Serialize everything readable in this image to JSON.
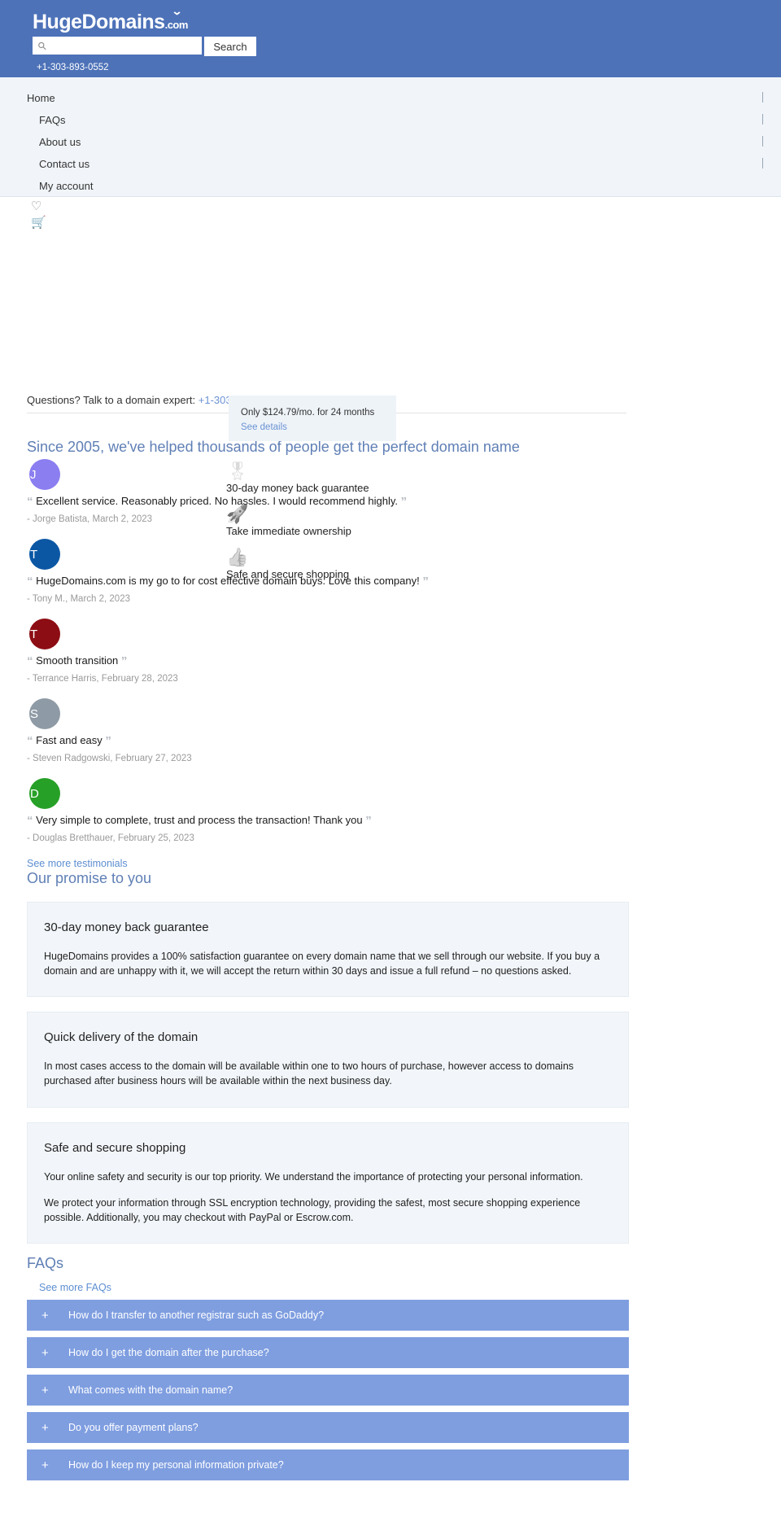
{
  "header": {
    "logo_main": "HugeDomains",
    "logo_suffix": ".com",
    "search_placeholder": "",
    "search_value": "",
    "search_button": "Search",
    "phone": "+1-303-893-0552",
    "search_icon": "search-icon",
    "brand_color": "#4d72b8"
  },
  "nav": {
    "items": [
      {
        "label": "Home",
        "sub": false
      },
      {
        "label": "FAQs",
        "sub": true
      },
      {
        "label": "About us",
        "sub": true
      },
      {
        "label": "Contact us",
        "sub": true
      },
      {
        "label": "My account",
        "sub": true
      }
    ],
    "icons": [
      {
        "name": "heart-icon",
        "glyph": "♡"
      },
      {
        "name": "cart-icon",
        "glyph": "Ὥ2"
      }
    ]
  },
  "questions": {
    "text": "Questions? Talk to a domain expert:",
    "phone": "+1-303-893-0552"
  },
  "price_tooltip": {
    "text": "Only $124.79/mo. for 24 months",
    "link": "See details"
  },
  "testimonials_section": {
    "heading": "Since 2005, we've helped thousands of people get the perfect domain name",
    "more_link": "See more testimonials",
    "items": [
      {
        "initial": "J",
        "color": "#8b7ef0",
        "quote": "Excellent service. Reasonably priced. No hassles. I would recommend highly.",
        "author": "- Jorge Batista, March 2, 2023"
      },
      {
        "initial": "T",
        "color": "#0b57a4",
        "quote": "HugeDomains.com is my go to for cost effective domain buys. Love this company!",
        "author": "- Tony M., March 2, 2023"
      },
      {
        "initial": "T",
        "color": "#8c0d13",
        "quote": "Smooth transition",
        "author": "- Terrance Harris, February 28, 2023"
      },
      {
        "initial": "S",
        "color": "#8e9aa5",
        "quote": "Fast and easy",
        "author": "- Steven Radgowski, February 27, 2023"
      },
      {
        "initial": "D",
        "color": "#27a027",
        "quote": "Very simple to complete, trust and process the transaction! Thank you",
        "author": "- Douglas Bretthauer, February 25, 2023"
      }
    ]
  },
  "features": [
    {
      "icon": "rosette-icon",
      "glyph": "Ἱ6",
      "label": "30-day money back guarantee"
    },
    {
      "icon": "rocket-icon",
      "glyph": "Ὠ0",
      "label": "Take immediate ownership"
    },
    {
      "icon": "thumbs-up-icon",
      "glyph": "ὄD",
      "label": "Safe and secure shopping"
    }
  ],
  "promise": {
    "heading": "Our promise to you",
    "cards": [
      {
        "title": "30-day money back guarantee",
        "paragraphs": [
          "HugeDomains provides a 100% satisfaction guarantee on every domain name that we sell through our website. If you buy a domain and are unhappy with it, we will accept the return within 30 days and issue a full refund – no questions asked."
        ]
      },
      {
        "title": "Quick delivery of the domain",
        "paragraphs": [
          "In most cases access to the domain will be available within one to two hours of purchase, however access to domains purchased after business hours will be available within the next business day."
        ]
      },
      {
        "title": "Safe and secure shopping",
        "paragraphs": [
          "Your online safety and security is our top priority. We understand the importance of protecting your personal information.",
          "We protect your information through SSL encryption technology, providing the safest, most secure shopping experience possible. Additionally, you may checkout with PayPal or Escrow.com."
        ]
      }
    ]
  },
  "faqs": {
    "heading": "FAQs",
    "more_link": "See more FAQs",
    "items": [
      {
        "plus": "+",
        "question": "How do I transfer to another registrar such as GoDaddy?"
      },
      {
        "plus": "+",
        "question": "How do I get the domain after the purchase?"
      },
      {
        "plus": "+",
        "question": "What comes with the domain name?"
      },
      {
        "plus": "+",
        "question": "Do you offer payment plans?"
      },
      {
        "plus": "+",
        "question": "How do I keep my personal information private?"
      }
    ]
  }
}
